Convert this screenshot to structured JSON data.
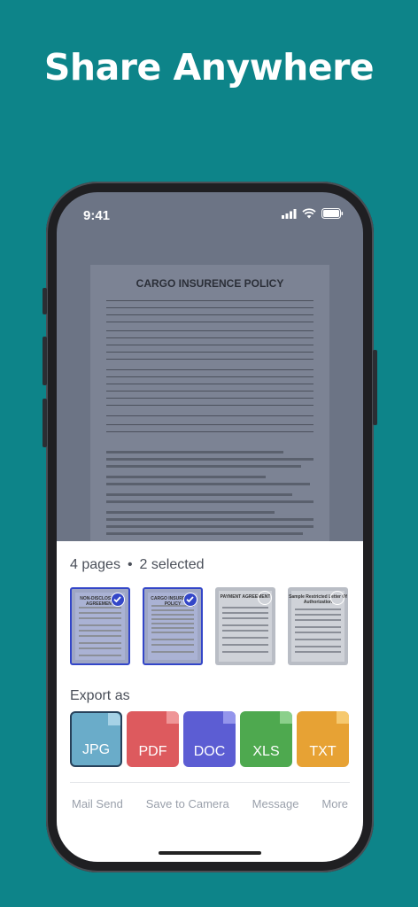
{
  "headline": "Share Anywhere",
  "status": {
    "time": "9:41"
  },
  "document": {
    "title": "CARGO INSURENCE POLICY"
  },
  "sheet": {
    "pages_label": "4 pages",
    "dot": "•",
    "selected_label": "2 selected",
    "thumbnails": [
      {
        "title": "NON-DISCLOSURE AGREEMENT",
        "selected": true
      },
      {
        "title": "CARGO INSURENCE POLICY",
        "selected": true
      },
      {
        "title": "PAYMENT AGREEMENT",
        "selected": false
      },
      {
        "title": "Sample Restricted Letter Of Authorization",
        "selected": false
      }
    ],
    "export_label": "Export as",
    "formats": [
      {
        "label": "JPG",
        "color": "#6aacc9",
        "fold": "#a6d2e6"
      },
      {
        "label": "PDF",
        "color": "#dd5a5e",
        "fold": "#ef9597"
      },
      {
        "label": "DOC",
        "color": "#5c5dd3",
        "fold": "#9495ec"
      },
      {
        "label": "XLS",
        "color": "#4ea94f",
        "fold": "#8bd08b"
      },
      {
        "label": "TXT",
        "color": "#e7a234",
        "fold": "#f6c96f"
      }
    ],
    "actions": [
      "Mail Send",
      "Save to Camera",
      "Message",
      "More"
    ]
  },
  "colors": {
    "background": "#0d8489",
    "accent": "#3346c8"
  }
}
